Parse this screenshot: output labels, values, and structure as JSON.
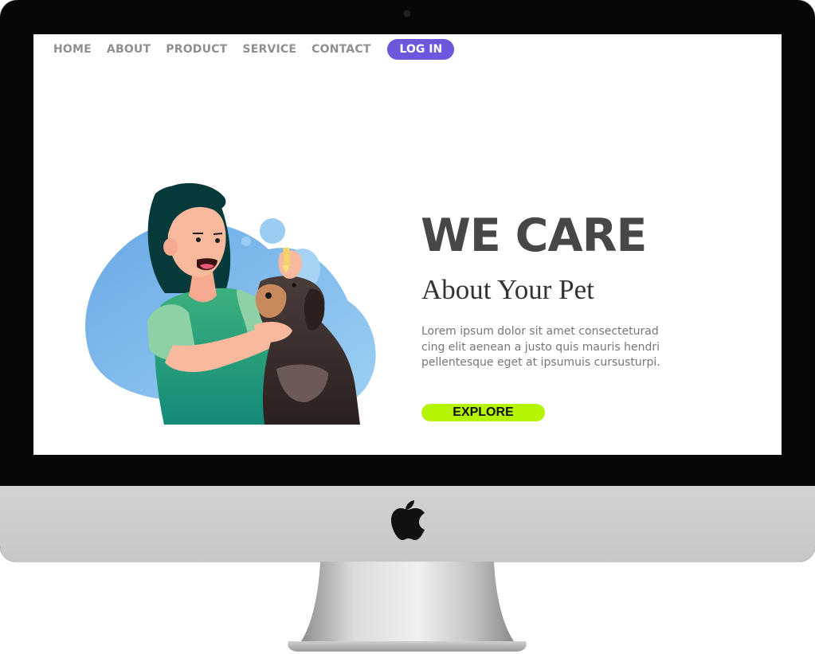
{
  "nav": {
    "items": [
      {
        "label": "HOME"
      },
      {
        "label": "ABOUT"
      },
      {
        "label": "PRODUCT"
      },
      {
        "label": "SERVICE"
      },
      {
        "label": "CONTACT"
      }
    ],
    "login_label": "LOG IN"
  },
  "hero": {
    "title": "WE CARE",
    "subtitle": "About Your Pet",
    "body_lines": [
      "Lorem ipsum dolor sit amet consecteturad",
      "cing elit aenean a justo quis mauris hendri",
      "pellentesque eget at ipsumuis cursusturpi."
    ],
    "cta_label": "EXPLORE"
  },
  "colors": {
    "login_button": "#6b58dc",
    "explore_button": "#b4f400",
    "heading": "#474747",
    "nav_text": "#8f8f8f",
    "monitor_bezel": "#070707",
    "monitor_chin": "#cdcdcd"
  },
  "icons": [
    "apple-logo-icon",
    "webcam-icon"
  ]
}
